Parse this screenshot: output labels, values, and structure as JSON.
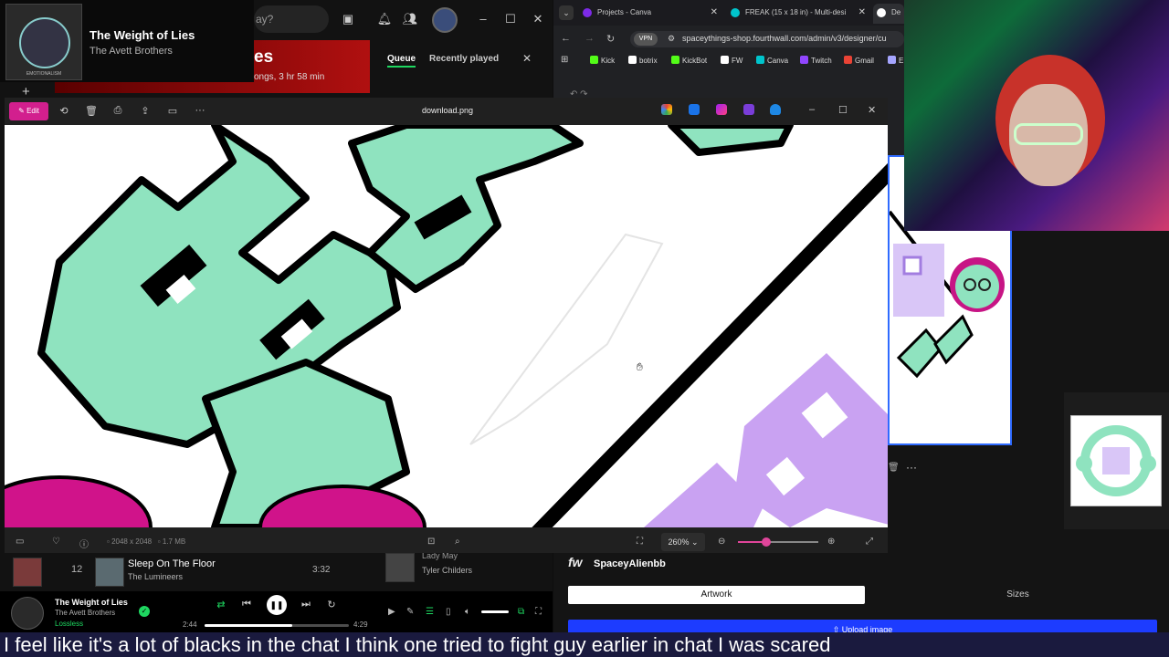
{
  "spotify": {
    "now_playing_card": {
      "title": "The Weight of Lies",
      "artist": "The Avett Brothers",
      "art_caption": "EMOTIONALISM"
    },
    "search_placeholder": "ay?",
    "banner": {
      "title": "es",
      "subtitle": "ongs, 3 hr 58 min"
    },
    "queue_panel": {
      "tab_queue": "Queue",
      "tab_recent": "Recently played",
      "close": "✕"
    },
    "tracks": [
      {
        "number": "12",
        "title": "Sleep On The Floor",
        "artist": "The Lumineers",
        "duration": "3:32"
      },
      {
        "title": "Lady May",
        "artist": "Tyler Childers"
      }
    ],
    "player": {
      "title": "The Weight of Lies",
      "artist": "The Avett Brothers",
      "quality": "Lossless",
      "current_time": "2:44",
      "total_time": "4:29",
      "progress_fraction": 0.61
    }
  },
  "browser": {
    "tabs": [
      {
        "title": "Projects - Canva",
        "favicon_color": "#7d2ae8"
      },
      {
        "title": "FREAK (15 x 18 in) - Multi-desi",
        "favicon_color": "#00c4cc"
      },
      {
        "title": "De",
        "favicon_color": "#ffffff"
      }
    ],
    "vpn_label": "VPN",
    "url": "spaceythings-shop.fourthwall.com/admin/v3/designer/cu",
    "bookmarks": [
      {
        "label": "Kick",
        "color": "#53fc18"
      },
      {
        "label": "botrix",
        "color": "#ffffff"
      },
      {
        "label": "KickBot",
        "color": "#53fc18"
      },
      {
        "label": "FW",
        "color": "#ffffff"
      },
      {
        "label": "Canva",
        "color": "#00c4cc"
      },
      {
        "label": "Twitch",
        "color": "#9146ff"
      },
      {
        "label": "Gmail",
        "color": "#ea4335"
      },
      {
        "label": "E",
        "color": "#a5a5ff"
      }
    ]
  },
  "designer": {
    "store_name": "SpaceyAlienbb",
    "fw_logo": "fw",
    "artwork_tab": "Artwork",
    "sizes_tab": "Sizes",
    "upload_button": "⇧ Upload image"
  },
  "photo_viewer": {
    "edit_label": "Edit",
    "filename": "download.png",
    "dimensions": "2048 x 2048",
    "file_size": "1.7 MB",
    "zoom": "260%",
    "zoom_fraction": 0.35
  },
  "caption": "I feel like it's a lot of blacks in the chat I think one tried to fight guy earlier in chat I was scared",
  "colors": {
    "spotify_green": "#1ed760",
    "edit_pink": "#d21f8e",
    "mint": "#8fe3bf",
    "lavender": "#c9a2f2",
    "magenta": "#d0138a"
  }
}
